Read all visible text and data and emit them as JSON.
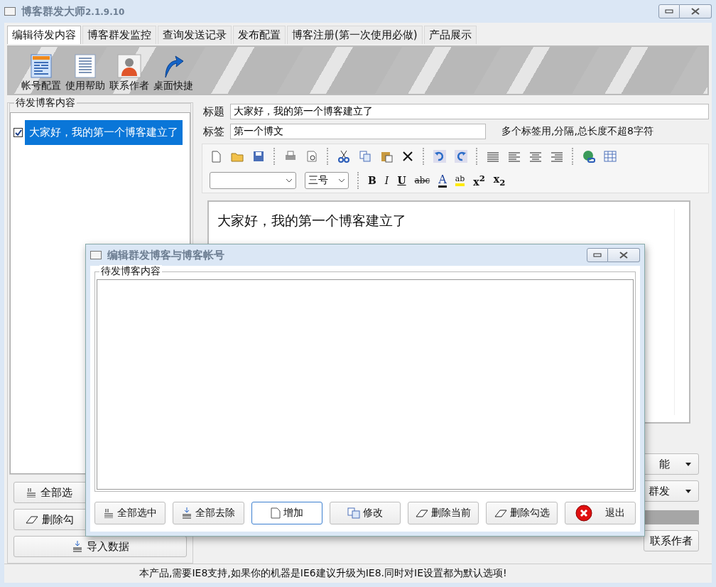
{
  "window": {
    "title": "博客群发大师",
    "version": "2.1.9.10"
  },
  "tabs": [
    {
      "label": "编辑待发内容",
      "selected": true
    },
    {
      "label": "博客群发监控",
      "selected": false
    },
    {
      "label": "查询发送记录",
      "selected": false
    },
    {
      "label": "发布配置",
      "selected": false
    },
    {
      "label": "博客注册(第一次使用必做)",
      "selected": false
    },
    {
      "label": "产品展示",
      "selected": false
    }
  ],
  "toolbar": [
    {
      "label": "帐号配置",
      "kind": "account"
    },
    {
      "label": "使用帮助",
      "kind": "help"
    },
    {
      "label": "联系作者",
      "kind": "contact"
    },
    {
      "label": "桌面快捷",
      "kind": "shortcut"
    }
  ],
  "left_panel": {
    "title": "待发博客内容",
    "items": [
      {
        "label": "大家好，我的第一个博客建立了",
        "checked": true,
        "selected": true
      }
    ],
    "buttons": [
      {
        "label": "全部选",
        "kind": "select-all"
      },
      {
        "label": "删除勾",
        "kind": "eraser"
      },
      {
        "label": "导入数据",
        "kind": "import"
      }
    ]
  },
  "form": {
    "title_label": "标题",
    "title_value": "大家好，我的第一个博客建立了",
    "tags_label": "标签",
    "tags_value": "第一个博文",
    "tags_hint": "多个标签用,分隔,总长度不超8字符"
  },
  "editor": {
    "font_size": "三号",
    "format_buttons": [
      {
        "label": "B",
        "kind": "bold"
      },
      {
        "label": "I",
        "kind": "italic"
      },
      {
        "label": "U",
        "kind": "underline"
      },
      {
        "label": "abc",
        "kind": "strike"
      },
      {
        "label": "A",
        "kind": "font-color"
      },
      {
        "label": "ab",
        "kind": "highlight"
      },
      {
        "label": "x$^{2}$",
        "kind": "script"
      },
      {
        "label": "x$_{2}$",
        "kind": "script"
      }
    ],
    "content": "大家好，我的第一个博客建立了"
  },
  "right_buttons": [
    {
      "label": "能"
    },
    {
      "label": "群发"
    }
  ],
  "contact_button": "联系作者",
  "status_bar": "本产品,需要IE8支持,如果你的机器是IE6建议升级为IE8.同时对IE设置都为默认选项!",
  "dialog": {
    "title": "编辑群发博客与博客帐号",
    "group_title": "待发博客内容",
    "buttons": [
      {
        "label": "全部选中",
        "kind": "select-all",
        "default": false
      },
      {
        "label": "全部去除",
        "kind": "import",
        "default": false
      },
      {
        "label": "增加",
        "kind": "new",
        "default": true
      },
      {
        "label": "修改",
        "kind": "copy",
        "default": false
      },
      {
        "label": "删除当前",
        "kind": "eraser",
        "default": false
      },
      {
        "label": "删除勾选",
        "kind": "eraser",
        "default": false
      },
      {
        "label": "退出",
        "kind": "exit",
        "default": false
      }
    ]
  }
}
